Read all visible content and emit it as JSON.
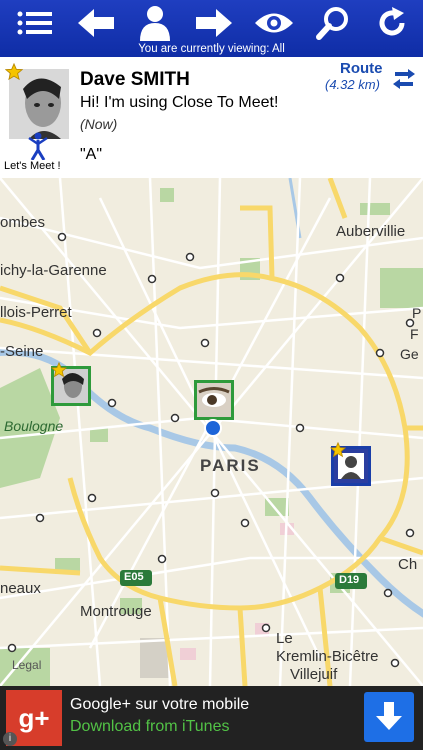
{
  "toolbar": {
    "viewing_text": "You are currently viewing: All"
  },
  "profile": {
    "name": "Dave SMITH",
    "status": "Hi! I'm using Close To Meet!",
    "time": "(Now)",
    "quote": "\"A\"",
    "meet_label": "Let's Meet !",
    "route_label": "Route",
    "distance": "(4.32 km)"
  },
  "map": {
    "labels": {
      "aubervilliers": "Aubervillie",
      "combes": "ombes",
      "clichy": "ichy-la-Garenne",
      "levallois": "llois-Perret",
      "seine": "-Seine",
      "boulogne": "Boulogne",
      "paris": "PARIS",
      "gentilly_e": "P",
      "gentilly_f": "F",
      "gentilly_g": "Ge",
      "montrouge": "Montrouge",
      "neaux": "neaux",
      "kremlin1": "Le",
      "kremlin2": "Kremlin-Bicêtre",
      "villejuif": "Villejuif",
      "ch": "Ch",
      "legal": "Legal",
      "e05": "E05",
      "d19": "D19"
    }
  },
  "ad": {
    "logo_text": "g+",
    "title": "Google+ sur votre mobile",
    "subtitle": "Download from iTunes",
    "info": "i"
  }
}
